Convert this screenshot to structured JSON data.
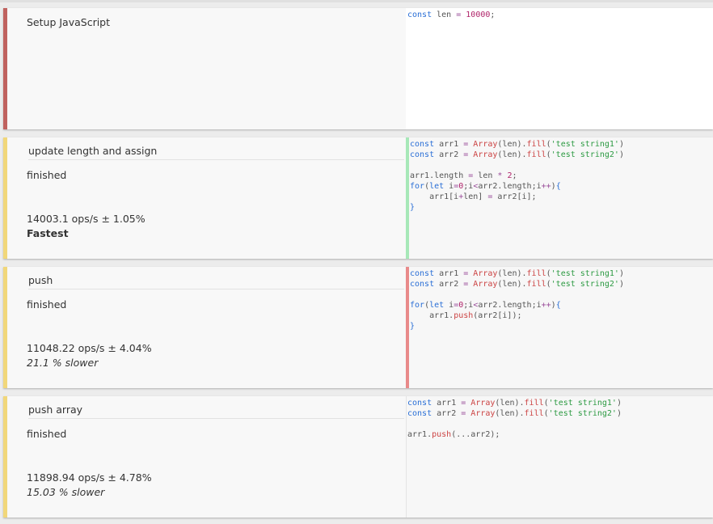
{
  "colors": {
    "setup_stripe": "#c0625f",
    "test_stripe": "#f1d77a",
    "fastest_bar": "#a7e8b8",
    "slower_bar": "#e98a8a"
  },
  "setup": {
    "label": "Setup JavaScript",
    "code": [
      [
        [
          "kw",
          "const"
        ],
        [
          "t",
          " len "
        ],
        [
          "op",
          "="
        ],
        [
          "t",
          " "
        ],
        [
          "num",
          "10000"
        ],
        [
          "t",
          ";"
        ]
      ]
    ]
  },
  "tests": [
    {
      "title": "update length and assign",
      "status": "finished",
      "ops": "14003.1 ops/s ± 1.05%",
      "rank": "Fastest",
      "rank_kind": "fast",
      "code": [
        [
          [
            "kw",
            "const"
          ],
          [
            "t",
            " arr1 "
          ],
          [
            "op",
            "="
          ],
          [
            "t",
            " "
          ],
          [
            "fn",
            "Array"
          ],
          [
            "t",
            "(len)."
          ],
          [
            "fn",
            "fill"
          ],
          [
            "t",
            "("
          ],
          [
            "str",
            "'test string1'"
          ],
          [
            "t",
            ")"
          ]
        ],
        [
          [
            "kw",
            "const"
          ],
          [
            "t",
            " arr2 "
          ],
          [
            "op",
            "="
          ],
          [
            "t",
            " "
          ],
          [
            "fn",
            "Array"
          ],
          [
            "t",
            "(len)."
          ],
          [
            "fn",
            "fill"
          ],
          [
            "t",
            "("
          ],
          [
            "str",
            "'test string2'"
          ],
          [
            "t",
            ")"
          ]
        ],
        [],
        [
          [
            "t",
            "arr1.length "
          ],
          [
            "op",
            "="
          ],
          [
            "t",
            " len "
          ],
          [
            "op",
            "*"
          ],
          [
            "t",
            " "
          ],
          [
            "num",
            "2"
          ],
          [
            "t",
            ";"
          ]
        ],
        [
          [
            "kw",
            "for"
          ],
          [
            "t",
            "("
          ],
          [
            "kw",
            "let"
          ],
          [
            "t",
            " i"
          ],
          [
            "op",
            "="
          ],
          [
            "num",
            "0"
          ],
          [
            "t",
            ";i"
          ],
          [
            "op",
            "<"
          ],
          [
            "t",
            "arr2.length;i"
          ],
          [
            "op",
            "++"
          ],
          [
            "t",
            ")"
          ],
          [
            "kw",
            "{"
          ]
        ],
        [
          [
            "t",
            "    arr1[i"
          ],
          [
            "op",
            "+"
          ],
          [
            "t",
            "len] "
          ],
          [
            "op",
            "="
          ],
          [
            "t",
            " arr2[i];"
          ]
        ],
        [
          [
            "kw",
            "}"
          ]
        ]
      ]
    },
    {
      "title": "push",
      "status": "finished",
      "ops": "11048.22 ops/s ± 4.04%",
      "rank": "21.1 % slower",
      "rank_kind": "slow",
      "code": [
        [
          [
            "kw",
            "const"
          ],
          [
            "t",
            " arr1 "
          ],
          [
            "op",
            "="
          ],
          [
            "t",
            " "
          ],
          [
            "fn",
            "Array"
          ],
          [
            "t",
            "(len)."
          ],
          [
            "fn",
            "fill"
          ],
          [
            "t",
            "("
          ],
          [
            "str",
            "'test string1'"
          ],
          [
            "t",
            ")"
          ]
        ],
        [
          [
            "kw",
            "const"
          ],
          [
            "t",
            " arr2 "
          ],
          [
            "op",
            "="
          ],
          [
            "t",
            " "
          ],
          [
            "fn",
            "Array"
          ],
          [
            "t",
            "(len)."
          ],
          [
            "fn",
            "fill"
          ],
          [
            "t",
            "("
          ],
          [
            "str",
            "'test string2'"
          ],
          [
            "t",
            ")"
          ]
        ],
        [],
        [
          [
            "kw",
            "for"
          ],
          [
            "t",
            "("
          ],
          [
            "kw",
            "let"
          ],
          [
            "t",
            " i"
          ],
          [
            "op",
            "="
          ],
          [
            "num",
            "0"
          ],
          [
            "t",
            ";i"
          ],
          [
            "op",
            "<"
          ],
          [
            "t",
            "arr2.length;i"
          ],
          [
            "op",
            "++"
          ],
          [
            "t",
            ")"
          ],
          [
            "kw",
            "{"
          ]
        ],
        [
          [
            "t",
            "    arr1."
          ],
          [
            "fn",
            "push"
          ],
          [
            "t",
            "(arr2[i]);"
          ]
        ],
        [
          [
            "kw",
            "}"
          ]
        ]
      ]
    },
    {
      "title": "push array",
      "status": "finished",
      "ops": "11898.94 ops/s ± 4.78%",
      "rank": "15.03 % slower",
      "rank_kind": "slow",
      "code": [
        [
          [
            "kw",
            "const"
          ],
          [
            "t",
            " arr1 "
          ],
          [
            "op",
            "="
          ],
          [
            "t",
            " "
          ],
          [
            "fn",
            "Array"
          ],
          [
            "t",
            "(len)."
          ],
          [
            "fn",
            "fill"
          ],
          [
            "t",
            "("
          ],
          [
            "str",
            "'test string1'"
          ],
          [
            "t",
            ")"
          ]
        ],
        [
          [
            "kw",
            "const"
          ],
          [
            "t",
            " arr2 "
          ],
          [
            "op",
            "="
          ],
          [
            "t",
            " "
          ],
          [
            "fn",
            "Array"
          ],
          [
            "t",
            "(len)."
          ],
          [
            "fn",
            "fill"
          ],
          [
            "t",
            "("
          ],
          [
            "str",
            "'test string2'"
          ],
          [
            "t",
            ")"
          ]
        ],
        [],
        [
          [
            "t",
            "arr1."
          ],
          [
            "fn",
            "push"
          ],
          [
            "t",
            "(...arr2);"
          ]
        ]
      ]
    }
  ]
}
